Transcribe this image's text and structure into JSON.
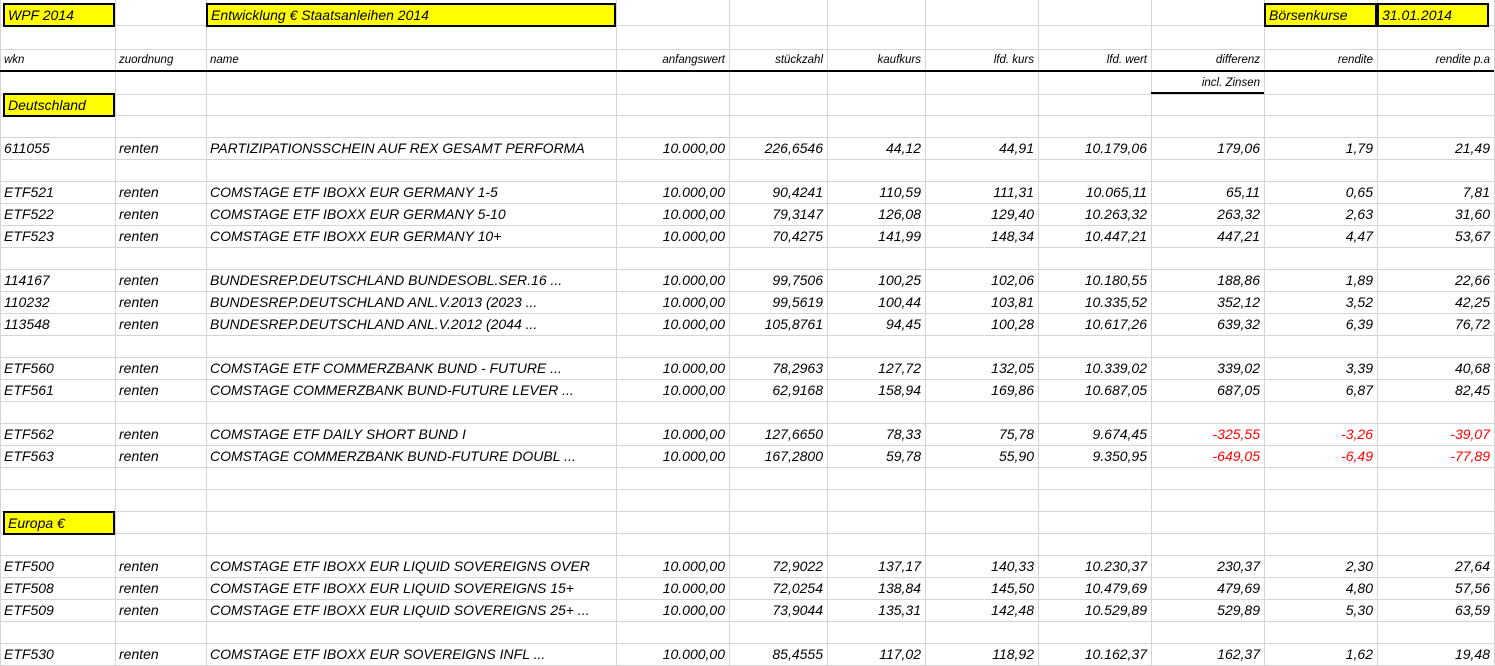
{
  "header": {
    "portfolio": "WPF 2014",
    "title": "Entwicklung € Staatsanleihen 2014",
    "kurse_label": "Börsenkurse",
    "date": "31.01.2014"
  },
  "columns": [
    "wkn",
    "zuordnung",
    "name",
    "anfangswert",
    "stückzahl",
    "kaufkurs",
    "lfd. kurs",
    "lfd. wert",
    "differenz",
    "rendite",
    "rendite p.a"
  ],
  "subheader": {
    "differenz_note": "incl. Zinsen"
  },
  "sections": {
    "deutschland": "Deutschland",
    "europa": "Europa €"
  },
  "colors": {
    "highlight": "#ffff00",
    "negative": "#ff0000",
    "grid": "#d4d4d4"
  },
  "rows_de": [
    {
      "wkn": "611055",
      "zuordnung": "renten",
      "name": "PARTIZIPATIONSSCHEIN AUF REX GESAMT PERFORMA",
      "anfangswert": "10.000,00",
      "stueckzahl": "226,6546",
      "kaufkurs": "44,12",
      "lfd_kurs": "44,91",
      "lfd_wert": "10.179,06",
      "differenz": "179,06",
      "rendite": "1,79",
      "rendite_pa": "21,49"
    },
    {
      "wkn": "ETF521",
      "zuordnung": "renten",
      "name": "COMSTAGE ETF IBOXX EUR GERMANY 1-5",
      "anfangswert": "10.000,00",
      "stueckzahl": "90,4241",
      "kaufkurs": "110,59",
      "lfd_kurs": "111,31",
      "lfd_wert": "10.065,11",
      "differenz": "65,11",
      "rendite": "0,65",
      "rendite_pa": "7,81"
    },
    {
      "wkn": "ETF522",
      "zuordnung": "renten",
      "name": "COMSTAGE ETF IBOXX EUR GERMANY 5-10",
      "anfangswert": "10.000,00",
      "stueckzahl": "79,3147",
      "kaufkurs": "126,08",
      "lfd_kurs": "129,40",
      "lfd_wert": "10.263,32",
      "differenz": "263,32",
      "rendite": "2,63",
      "rendite_pa": "31,60"
    },
    {
      "wkn": "ETF523",
      "zuordnung": "renten",
      "name": "COMSTAGE ETF IBOXX EUR GERMANY 10+",
      "anfangswert": "10.000,00",
      "stueckzahl": "70,4275",
      "kaufkurs": "141,99",
      "lfd_kurs": "148,34",
      "lfd_wert": "10.447,21",
      "differenz": "447,21",
      "rendite": "4,47",
      "rendite_pa": "53,67"
    },
    {
      "wkn": "114167",
      "zuordnung": "renten",
      "name": "BUNDESREP.DEUTSCHLAND BUNDESOBL.SER.16 ...",
      "anfangswert": "10.000,00",
      "stueckzahl": "99,7506",
      "kaufkurs": "100,25",
      "lfd_kurs": "102,06",
      "lfd_wert": "10.180,55",
      "differenz": "188,86",
      "rendite": "1,89",
      "rendite_pa": "22,66"
    },
    {
      "wkn": "110232",
      "zuordnung": "renten",
      "name": "BUNDESREP.DEUTSCHLAND ANL.V.2013 (2023 ...",
      "anfangswert": "10.000,00",
      "stueckzahl": "99,5619",
      "kaufkurs": "100,44",
      "lfd_kurs": "103,81",
      "lfd_wert": "10.335,52",
      "differenz": "352,12",
      "rendite": "3,52",
      "rendite_pa": "42,25"
    },
    {
      "wkn": "113548",
      "zuordnung": "renten",
      "name": "BUNDESREP.DEUTSCHLAND ANL.V.2012 (2044 ...",
      "anfangswert": "10.000,00",
      "stueckzahl": "105,8761",
      "kaufkurs": "94,45",
      "lfd_kurs": "100,28",
      "lfd_wert": "10.617,26",
      "differenz": "639,32",
      "rendite": "6,39",
      "rendite_pa": "76,72"
    },
    {
      "wkn": "ETF560",
      "zuordnung": "renten",
      "name": "COMSTAGE ETF COMMERZBANK BUND - FUTURE ...",
      "anfangswert": "10.000,00",
      "stueckzahl": "78,2963",
      "kaufkurs": "127,72",
      "lfd_kurs": "132,05",
      "lfd_wert": "10.339,02",
      "differenz": "339,02",
      "rendite": "3,39",
      "rendite_pa": "40,68"
    },
    {
      "wkn": "ETF561",
      "zuordnung": "renten",
      "name": "COMSTAGE COMMERZBANK BUND-FUTURE LEVER ...",
      "anfangswert": "10.000,00",
      "stueckzahl": "62,9168",
      "kaufkurs": "158,94",
      "lfd_kurs": "169,86",
      "lfd_wert": "10.687,05",
      "differenz": "687,05",
      "rendite": "6,87",
      "rendite_pa": "82,45"
    },
    {
      "wkn": "ETF562",
      "zuordnung": "renten",
      "name": "COMSTAGE ETF DAILY SHORT BUND I",
      "anfangswert": "10.000,00",
      "stueckzahl": "127,6650",
      "kaufkurs": "78,33",
      "lfd_kurs": "75,78",
      "lfd_wert": "9.674,45",
      "differenz": "-325,55",
      "rendite": "-3,26",
      "rendite_pa": "-39,07"
    },
    {
      "wkn": "ETF563",
      "zuordnung": "renten",
      "name": "COMSTAGE COMMERZBANK BUND-FUTURE DOUBL ...",
      "anfangswert": "10.000,00",
      "stueckzahl": "167,2800",
      "kaufkurs": "59,78",
      "lfd_kurs": "55,90",
      "lfd_wert": "9.350,95",
      "differenz": "-649,05",
      "rendite": "-6,49",
      "rendite_pa": "-77,89"
    }
  ],
  "rows_eu": [
    {
      "wkn": "ETF500",
      "zuordnung": "renten",
      "name": "COMSTAGE ETF IBOXX EUR LIQUID SOVEREIGNS OVER",
      "anfangswert": "10.000,00",
      "stueckzahl": "72,9022",
      "kaufkurs": "137,17",
      "lfd_kurs": "140,33",
      "lfd_wert": "10.230,37",
      "differenz": "230,37",
      "rendite": "2,30",
      "rendite_pa": "27,64"
    },
    {
      "wkn": "ETF508",
      "zuordnung": "renten",
      "name": "COMSTAGE ETF IBOXX EUR LIQUID SOVEREIGNS 15+",
      "anfangswert": "10.000,00",
      "stueckzahl": "72,0254",
      "kaufkurs": "138,84",
      "lfd_kurs": "145,50",
      "lfd_wert": "10.479,69",
      "differenz": "479,69",
      "rendite": "4,80",
      "rendite_pa": "57,56"
    },
    {
      "wkn": "ETF509",
      "zuordnung": "renten",
      "name": "COMSTAGE ETF IBOXX EUR LIQUID SOVEREIGNS 25+ ...",
      "anfangswert": "10.000,00",
      "stueckzahl": "73,9044",
      "kaufkurs": "135,31",
      "lfd_kurs": "142,48",
      "lfd_wert": "10.529,89",
      "differenz": "529,89",
      "rendite": "5,30",
      "rendite_pa": "63,59"
    },
    {
      "wkn": "ETF530",
      "zuordnung": "renten",
      "name": "COMSTAGE ETF IBOXX EUR SOVEREIGNS INFL ...",
      "anfangswert": "10.000,00",
      "stueckzahl": "85,4555",
      "kaufkurs": "117,02",
      "lfd_kurs": "118,92",
      "lfd_wert": "10.162,37",
      "differenz": "162,37",
      "rendite": "1,62",
      "rendite_pa": "19,48"
    }
  ]
}
